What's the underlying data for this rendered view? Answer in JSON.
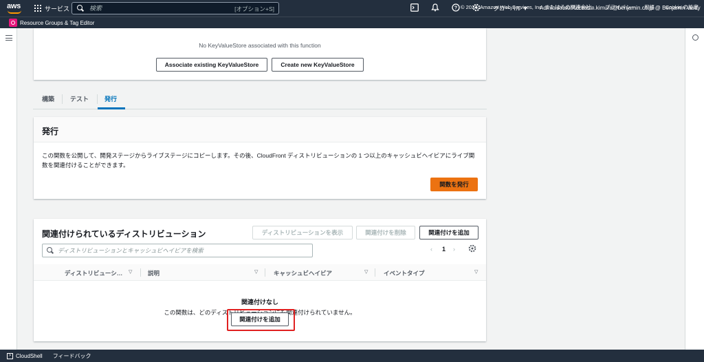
{
  "topnav": {
    "logo": "aws",
    "services_label": "サービス",
    "search_placeholder": "検索",
    "search_shortcut": "[オプション+S]",
    "region_label": "グローバル ▼",
    "account_label": "AdministratorAccess/n.kimura@benjamin.co.jp @ Benjamin Verify ▼",
    "icons": [
      "cloudshell-icon",
      "bell-icon",
      "help-icon",
      "settings-icon"
    ]
  },
  "subbar": {
    "app_label": "Resource Groups & Tag Editor"
  },
  "kvs": {
    "empty_text": "No KeyValueStore associated with this function",
    "associate_button": "Associate existing KeyValueStore",
    "create_button": "Create new KeyValueStore"
  },
  "tabs": [
    {
      "label": "構築"
    },
    {
      "label": "テスト"
    },
    {
      "label": "発行"
    }
  ],
  "publish": {
    "title": "発行",
    "description_line1": "この関数を公開して、開発ステージからライブステージにコピーします。その後、CloudFront ディストリビューションの 1 つ以上のキャッシュビヘイビアにライブ関",
    "description_line2": "数を関連付けることができます。",
    "publish_button": "関数を発行"
  },
  "associations": {
    "title": "関連付けられているディストリビューション",
    "view_button": "ディストリビューションを表示",
    "remove_button": "関連付けを削除",
    "add_button": "関連付けを追加",
    "filter_placeholder": "ディストリビューションとキャッシュビヘイビアを検索",
    "page_number": "1",
    "columns": [
      "ディストリビューシ…",
      "説明",
      "キャッシュビヘイビア",
      "イベントタイプ"
    ],
    "empty_title": "関連付けなし",
    "empty_text": "この関数は、どのディストリビューションにも関連付けられていません。",
    "empty_add_button": "関連付けを追加"
  },
  "footer": {
    "cloudshell": "CloudShell",
    "feedback": "フィードバック",
    "copyright": "© 2024, Amazon Web Services, Inc. またはその関連会社。",
    "privacy": "プライバシー",
    "terms": "用語",
    "cookie": "Cookie の設定"
  },
  "colors": {
    "nav_bg": "#232f3e",
    "accent_orange": "#ec7211",
    "link_blue": "#0073bb",
    "highlight_red": "#e02020"
  }
}
